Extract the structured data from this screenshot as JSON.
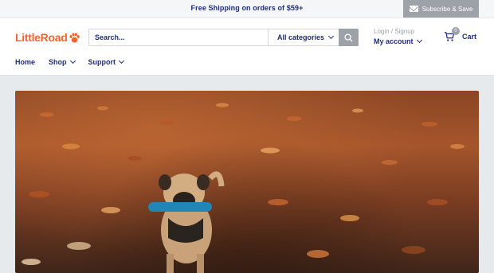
{
  "topbar": {
    "promo": "Free Shipping on orders of $59+",
    "subscribe_label": "Subscribe & Save",
    "subscribe_icon": "mail-icon"
  },
  "header": {
    "logo_text": "LittleRoad",
    "logo_icon": "paw-icon",
    "search": {
      "placeholder": "Search...",
      "category_label": "All categories",
      "search_icon": "search-icon"
    },
    "account": {
      "login_label": "Login / Signup",
      "account_label": "My account"
    },
    "cart": {
      "label": "Cart",
      "count": "0",
      "icon": "cart-icon"
    }
  },
  "nav": {
    "items": [
      {
        "label": "Home"
      },
      {
        "label": "Shop"
      },
      {
        "label": "Support"
      }
    ]
  },
  "colors": {
    "brand": "#ff6128",
    "text_primary": "#1e2d7d",
    "muted": "#9ca2a8",
    "page_bg": "#e7eaed"
  },
  "hero": {
    "image": "pug dog carrying blue toy on autumn leaves"
  }
}
